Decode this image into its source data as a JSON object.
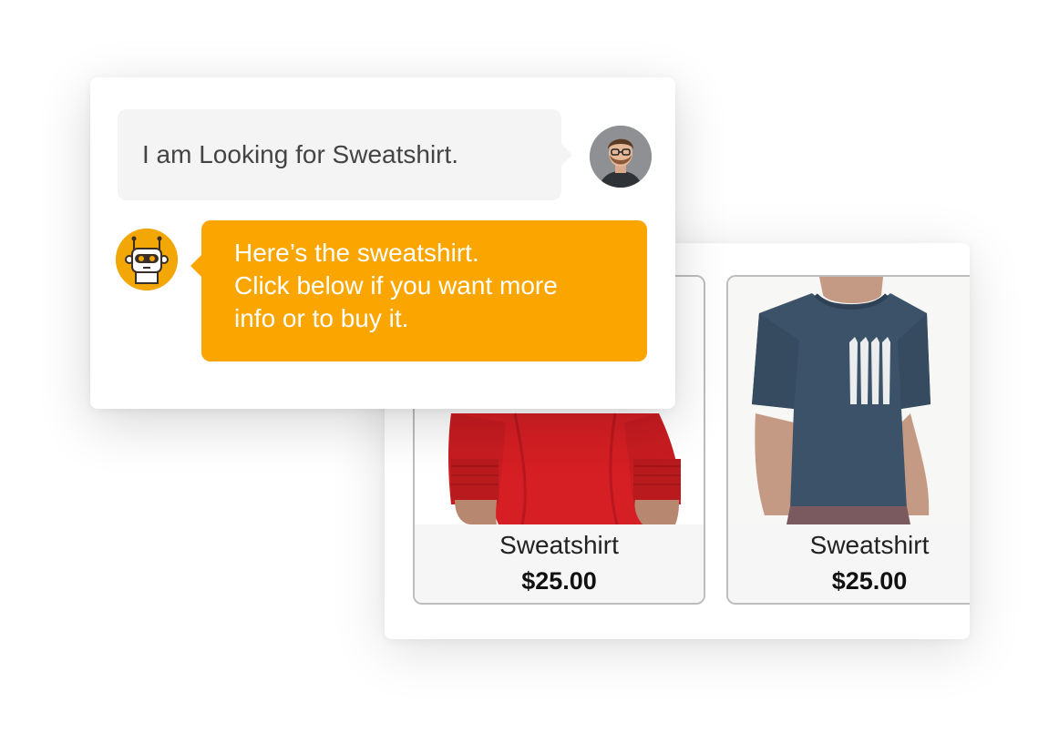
{
  "chat": {
    "user_message": "I am Looking for Sweatshirt.",
    "bot_message_lines": [
      "Here’s the sweatshirt.",
      "Click below if you want more",
      "info or to buy it."
    ],
    "user_avatar_icon": "user-photo-avatar",
    "bot_avatar_icon": "robot-icon",
    "bot_color": "#fba600",
    "user_bubble_color": "#f4f4f4"
  },
  "products": [
    {
      "name": "Sweatshirt",
      "price": "$25.00",
      "image": "red-long-sleeve-shirt"
    },
    {
      "name": "Sweatshirt",
      "price": "$25.00",
      "image": "navy-tshirt-with-stripes"
    }
  ]
}
